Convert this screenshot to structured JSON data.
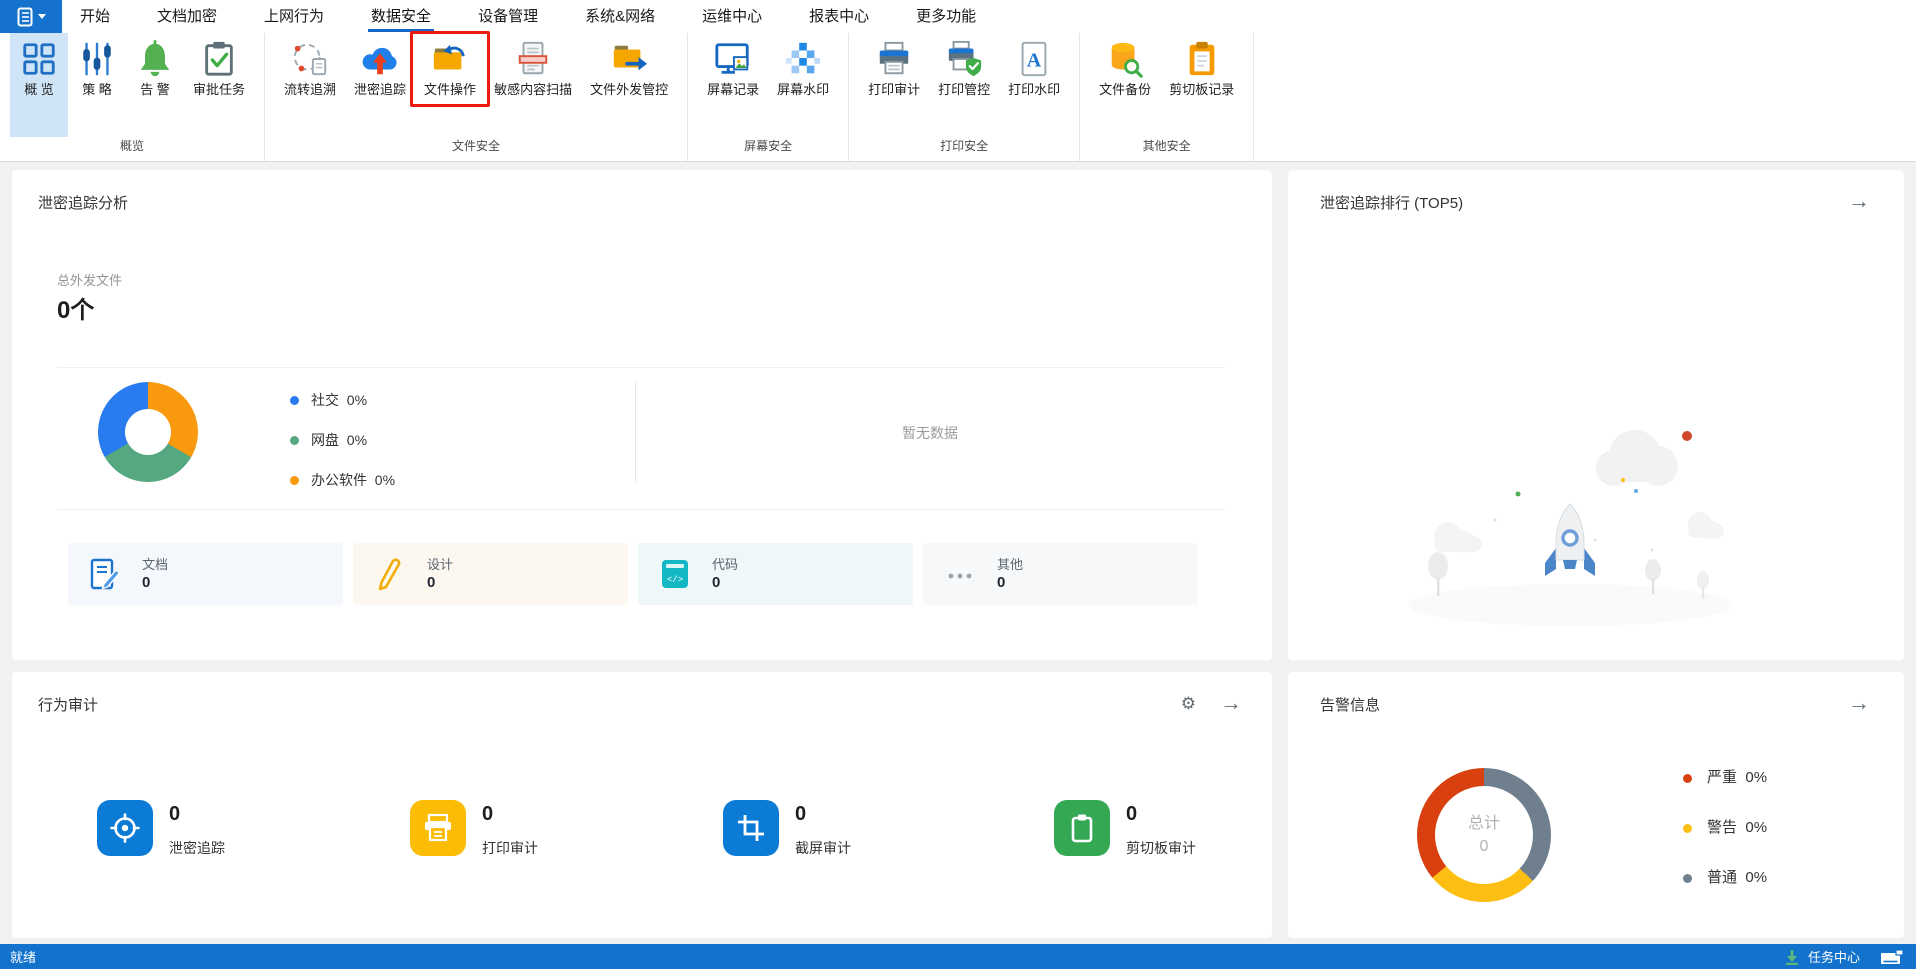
{
  "menu": {
    "items": [
      {
        "label": "开始",
        "active": false
      },
      {
        "label": "文档加密",
        "active": false
      },
      {
        "label": "上网行为",
        "active": false
      },
      {
        "label": "数据安全",
        "active": true
      },
      {
        "label": "设备管理",
        "active": false
      },
      {
        "label": "系统&网络",
        "active": false
      },
      {
        "label": "运维中心",
        "active": false
      },
      {
        "label": "报表中心",
        "active": false
      },
      {
        "label": "更多功能",
        "active": false
      }
    ]
  },
  "ribbon": {
    "groups": [
      {
        "label": "概览",
        "buttons": [
          {
            "label": "概 览",
            "icon": "overview-grid-icon",
            "selected": true
          },
          {
            "label": "策 略",
            "icon": "sliders-icon"
          },
          {
            "label": "告 警",
            "icon": "bell-icon"
          },
          {
            "label": "审批任务",
            "icon": "clipboard-check-icon"
          }
        ]
      },
      {
        "label": "文件安全",
        "buttons": [
          {
            "label": "流转追溯",
            "icon": "flow-trace-icon"
          },
          {
            "label": "泄密追踪",
            "icon": "cloud-upload-icon"
          },
          {
            "label": "文件操作",
            "icon": "folder-return-icon",
            "highlighted": true
          },
          {
            "label": "敏感内容扫描",
            "icon": "document-scan-icon"
          },
          {
            "label": "文件外发管控",
            "icon": "folder-export-icon"
          }
        ]
      },
      {
        "label": "屏幕安全",
        "buttons": [
          {
            "label": "屏幕记录",
            "icon": "monitor-record-icon"
          },
          {
            "label": "屏幕水印",
            "icon": "mosaic-watermark-icon"
          }
        ]
      },
      {
        "label": "打印安全",
        "buttons": [
          {
            "label": "打印审计",
            "icon": "printer-icon"
          },
          {
            "label": "打印管控",
            "icon": "printer-shield-icon"
          },
          {
            "label": "打印水印",
            "icon": "page-letter-icon"
          }
        ]
      },
      {
        "label": "其他安全",
        "buttons": [
          {
            "label": "文件备份",
            "icon": "database-search-icon"
          },
          {
            "label": "剪切板记录",
            "icon": "clipboard-record-icon"
          }
        ]
      }
    ]
  },
  "panels": {
    "leak_analysis": {
      "title": "泄密追踪分析",
      "total_label": "总外发文件",
      "total_value": "0个",
      "donut": {
        "type": "donut",
        "segments": [
          {
            "label": "社交",
            "pct": "0%",
            "color": "#2a7af0"
          },
          {
            "label": "网盘",
            "pct": "0%",
            "color": "#55a87f"
          },
          {
            "label": "办公软件",
            "pct": "0%",
            "color": "#f9990e"
          }
        ]
      },
      "empty_text": "暂无数据",
      "cards": [
        {
          "label": "文档",
          "value": "0",
          "icon": "document-pen-icon",
          "bg": "#f4f7fb"
        },
        {
          "label": "设计",
          "value": "0",
          "icon": "pencil-icon",
          "bg": "#fdf8ef"
        },
        {
          "label": "代码",
          "value": "0",
          "icon": "code-icon",
          "bg": "#eff8f8"
        },
        {
          "label": "其他",
          "value": "0",
          "icon": "ellipsis-icon",
          "bg": "#f7f8f9"
        }
      ]
    },
    "leak_ranking": {
      "title": "泄密追踪排行 (TOP5)"
    },
    "behavior_audit": {
      "title": "行为审计",
      "stats": [
        {
          "value": "0",
          "label": "泄密追踪",
          "icon": "target-icon",
          "color": "#0c7bd6"
        },
        {
          "value": "0",
          "label": "打印审计",
          "icon": "print-receipt-icon",
          "color": "#fbbc05"
        },
        {
          "value": "0",
          "label": "截屏审计",
          "icon": "crop-icon",
          "color": "#0c7bd6"
        },
        {
          "value": "0",
          "label": "剪切板审计",
          "icon": "clipboard-icon",
          "color": "#34a853"
        }
      ]
    },
    "alerts": {
      "title": "告警信息",
      "center_label": "总计",
      "center_value": "0",
      "donut": {
        "type": "donut",
        "segments": [
          {
            "label": "严重",
            "pct": "0%",
            "color": "#d8400f"
          },
          {
            "label": "警告",
            "pct": "0%",
            "color": "#fcbe12"
          },
          {
            "label": "普通",
            "pct": "0%",
            "color": "#6f7f8e"
          }
        ]
      }
    }
  },
  "statusbar": {
    "status": "就绪",
    "task_center": "任务中心"
  },
  "colors": {
    "accent_blue": "#1467c8",
    "app_button": "#1673cd",
    "ribbon_selected_bg": "#cfe4f6",
    "highlight_red": "#ec1b0c",
    "status_bar": "#1373cc",
    "content_bg": "#f1f1f2"
  }
}
